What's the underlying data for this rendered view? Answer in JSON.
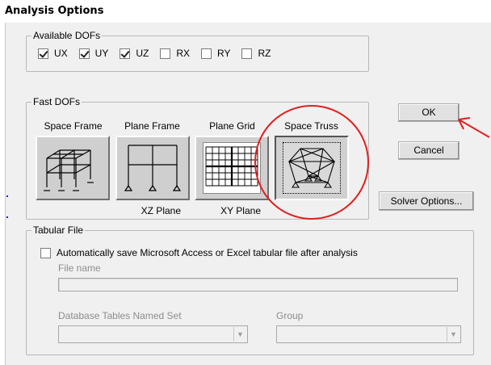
{
  "window": {
    "title": "Analysis Options"
  },
  "available_dofs": {
    "label": "Available DOFs",
    "items": [
      {
        "label": "UX",
        "checked": true
      },
      {
        "label": "UY",
        "checked": true
      },
      {
        "label": "UZ",
        "checked": true
      },
      {
        "label": "RX",
        "checked": false
      },
      {
        "label": "RY",
        "checked": false
      },
      {
        "label": "RZ",
        "checked": false
      }
    ]
  },
  "fast_dofs": {
    "label": "Fast DOFs",
    "options": [
      {
        "label": "Space Frame",
        "sub": "",
        "selected": false
      },
      {
        "label": "Plane Frame",
        "sub": "XZ Plane",
        "selected": false
      },
      {
        "label": "Plane Grid",
        "sub": "XY Plane",
        "selected": false
      },
      {
        "label": "Space Truss",
        "sub": "",
        "selected": true
      }
    ]
  },
  "buttons": {
    "ok": "OK",
    "cancel": "Cancel",
    "solver_options": "Solver Options..."
  },
  "tabular_file": {
    "label": "Tabular File",
    "auto_save_label": "Automatically save Microsoft Access or Excel tabular file after analysis",
    "auto_save_checked": false,
    "file_name_label": "File name",
    "file_name_value": "",
    "db_tables_label": "Database Tables Named Set",
    "db_tables_value": "",
    "group_label": "Group",
    "group_value": ""
  },
  "annotations": {
    "highlight_color": "#e02020"
  }
}
